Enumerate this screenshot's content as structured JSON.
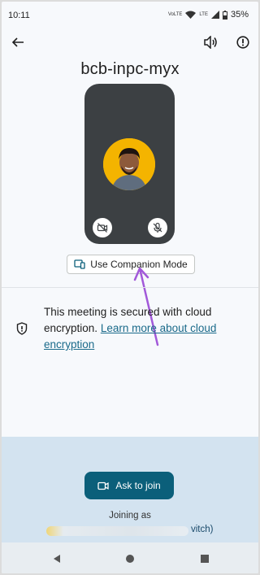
{
  "status_bar": {
    "time": "10:11",
    "net1_top": "VoLTE",
    "net2": "LTE",
    "battery": "35%"
  },
  "header": {
    "back": "back",
    "speaker": "speaker",
    "info": "info"
  },
  "meeting": {
    "code": "bcb-inpc-myx"
  },
  "companion": {
    "label": "Use Companion Mode"
  },
  "security": {
    "text": "This meeting is secured with cloud encryption.",
    "link": "Learn more about cloud encryption"
  },
  "join": {
    "button_label": "Ask to join",
    "joining_as": "Joining as",
    "account_suffix": "vitch)"
  },
  "colors": {
    "accent": "#0b5f7a",
    "bottom_panel": "#d3e3f0",
    "preview_bg": "#3c4043",
    "avatar_bg": "#f4b400",
    "annotation": "#a259d9"
  }
}
